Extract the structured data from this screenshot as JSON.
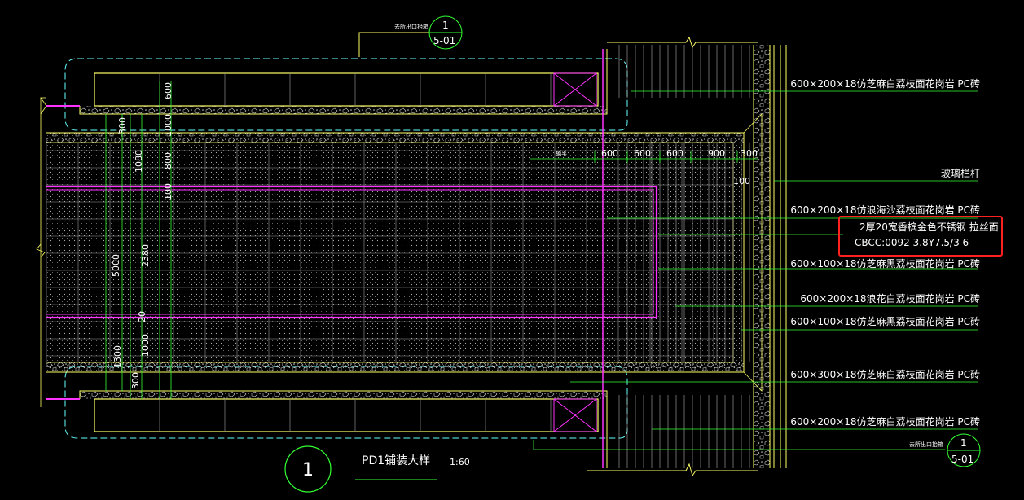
{
  "drawing": {
    "title": "PD1铺装大样",
    "scale": "1:60",
    "detail_number": "1",
    "ref_top": {
      "note": "去所出口抬箱",
      "number": "1",
      "sheet": "5-01"
    },
    "ref_bottom": {
      "note": "去所出口抬箱",
      "number": "1",
      "sheet": "5-01"
    }
  },
  "callouts": [
    {
      "text": "600×200×18仿芝麻白荔枝面花岗岩 PC砖"
    },
    {
      "text": "玻璃栏杆"
    },
    {
      "text": "600×200×18仿浪海沙荔枝面花岗岩 PC砖"
    },
    {
      "text": "2厚20宽香槟金色不锈钢 拉丝面"
    },
    {
      "text": "CBCC:0092 3.8Y7.5/3 6"
    },
    {
      "text": "600×100×18仿芝麻黑荔枝面花岗岩 PC砖"
    },
    {
      "text": "600×200×18浪花白荔枝面花岗岩 PC砖"
    },
    {
      "text": "600×100×18仿芝麻黑荔枝面花岗岩 PC砖"
    },
    {
      "text": "600×300×18仿芝麻白荔枝面花岗岩 PC砖"
    },
    {
      "text": "600×200×18仿芝麻白荔枝面花岗岩 PC砖"
    }
  ],
  "dimensions": {
    "horizontal": [
      "600",
      "600",
      "600",
      "900",
      "300"
    ],
    "horizontal_prefix": "轴平",
    "hundred": "100",
    "vertical_outer": "5000",
    "vertical_inner": "2380",
    "v_300a": "300",
    "v_1080": "1080",
    "v_1300": "1300",
    "v_600": "600",
    "v_1000a": "1000",
    "v_800": "800",
    "v_100": "100",
    "v_1000b": "1000",
    "v_20": "20",
    "v_300b": "300"
  },
  "colors": {
    "background": "#000000",
    "yellow": "#ffff66",
    "cyan": "#66ffff",
    "green": "#33ff33",
    "magenta": "#ff33ff",
    "white": "#ffffff",
    "red_highlight": "#ff2020"
  }
}
